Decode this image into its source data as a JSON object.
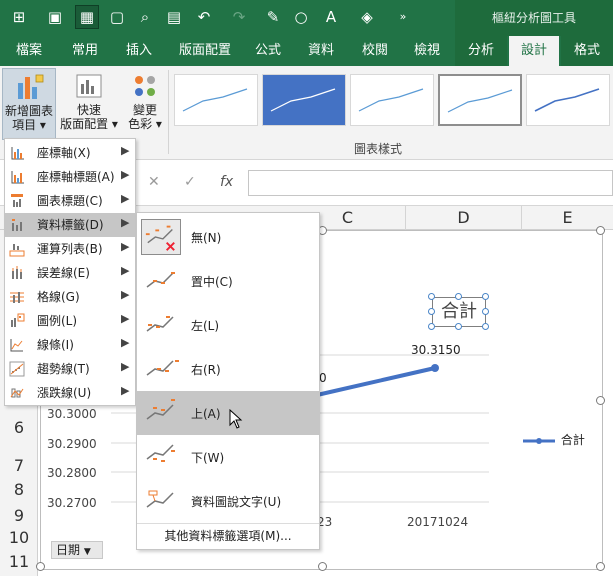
{
  "context_tab_title": "樞紐分析圖工具",
  "tabs": [
    {
      "label": "檔案",
      "state": "normal"
    },
    {
      "label": "常用",
      "state": "normal"
    },
    {
      "label": "插入",
      "state": "normal"
    },
    {
      "label": "版面配置",
      "state": "normal"
    },
    {
      "label": "公式",
      "state": "normal"
    },
    {
      "label": "資料",
      "state": "normal"
    },
    {
      "label": "校閱",
      "state": "normal"
    },
    {
      "label": "檢視",
      "state": "normal"
    },
    {
      "label": "分析",
      "state": "context"
    },
    {
      "label": "設計",
      "state": "selected"
    },
    {
      "label": "格式",
      "state": "context"
    }
  ],
  "ribbon": {
    "add_chart_element": {
      "line1": "新增圖表",
      "line2": "項目 ▾"
    },
    "quick_layout": {
      "line1": "快速",
      "line2": "版面配置 ▾"
    },
    "change_colors": {
      "line1": "變更",
      "line2": "色彩 ▾"
    },
    "chart_styles_group": "圖表樣式"
  },
  "formula_bar": {
    "cancel": "✕",
    "enter": "✓",
    "fx": "fx"
  },
  "columns": [
    "C",
    "D",
    "E"
  ],
  "rows": [
    "6",
    "7",
    "8",
    "9",
    "10",
    "11"
  ],
  "chart": {
    "title": "合計",
    "data_label": "30.3150",
    "partial_label": "0",
    "legend": "合計",
    "date_button": "日期",
    "series_color": "#4472c4"
  },
  "chart_data": {
    "type": "line",
    "y_tick_labels": [
      "30.3000",
      "30.2900",
      "30.2800",
      "30.2700"
    ],
    "x_tick_labels": [
      "23",
      "20171024"
    ],
    "series": [
      {
        "name": "合計",
        "values": [
          30.315
        ]
      }
    ],
    "data_labels": [
      "30.3150"
    ],
    "legend_position": "right"
  },
  "menu_primary": {
    "items": [
      {
        "label": "座標軸(X)"
      },
      {
        "label": "座標軸標題(A)"
      },
      {
        "label": "圖表標題(C)"
      },
      {
        "label": "資料標籤(D)"
      },
      {
        "label": "運算列表(B)"
      },
      {
        "label": "誤差線(E)"
      },
      {
        "label": "格線(G)"
      },
      {
        "label": "圖例(L)"
      },
      {
        "label": "線條(I)"
      },
      {
        "label": "趨勢線(T)"
      },
      {
        "label": "漲跌線(U)"
      }
    ]
  },
  "menu_data_labels": {
    "items": [
      {
        "label": "無(N)"
      },
      {
        "label": "置中(C)"
      },
      {
        "label": "左(L)"
      },
      {
        "label": "右(R)"
      },
      {
        "label": "上(A)"
      },
      {
        "label": "下(W)"
      },
      {
        "label": "資料圖說文字(U)"
      }
    ],
    "more": "其他資料標籤選項(M)..."
  }
}
